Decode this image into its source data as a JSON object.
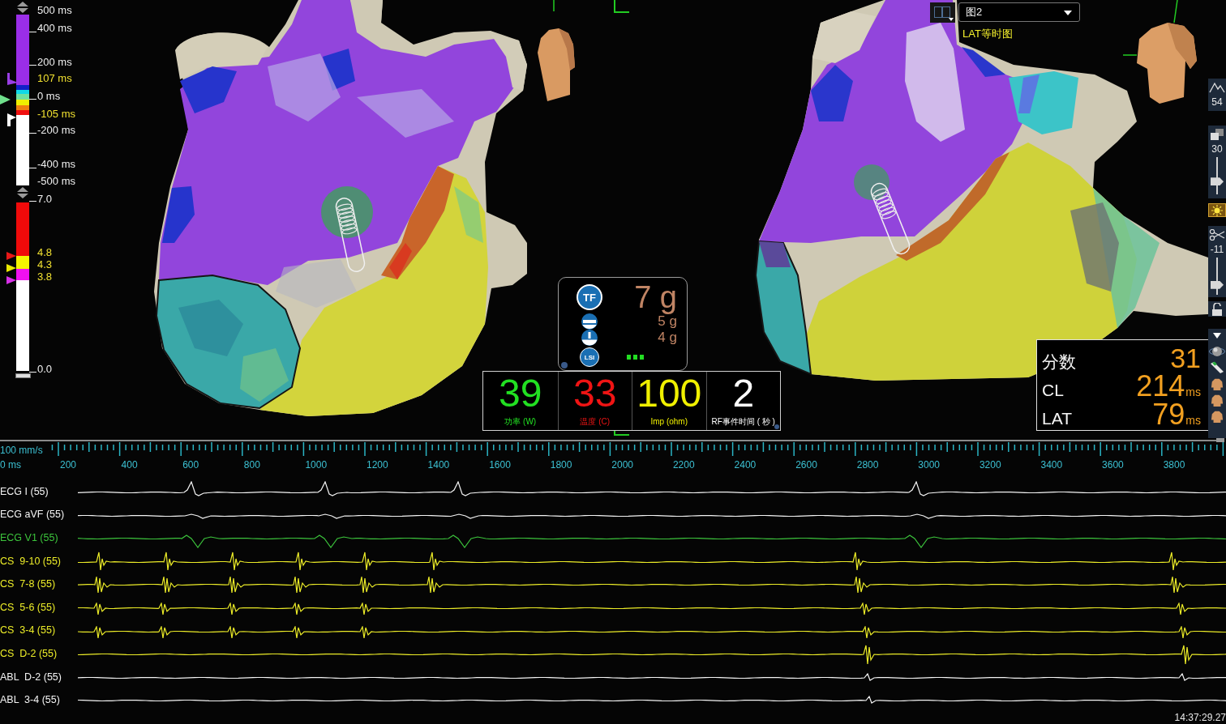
{
  "lat_scale": {
    "labels": [
      {
        "text": "500 ms",
        "kind": "tick"
      },
      {
        "text": "400 ms",
        "kind": "tick"
      },
      {
        "text": "200 ms",
        "kind": "tick"
      },
      {
        "text": "107 ms",
        "kind": "limit"
      },
      {
        "text": "0 ms",
        "kind": "tick"
      },
      {
        "text": "-105 ms",
        "kind": "limit"
      },
      {
        "text": "-200 ms",
        "kind": "tick"
      },
      {
        "text": "-400 ms",
        "kind": "tick"
      },
      {
        "text": "-500 ms",
        "kind": "tick"
      }
    ]
  },
  "voltage_scale": {
    "labels": [
      {
        "text": "7.0",
        "kind": "tick"
      },
      {
        "text": "4.8",
        "kind": "limit"
      },
      {
        "text": "4.3",
        "kind": "limit"
      },
      {
        "text": "3.8",
        "kind": "limit"
      },
      {
        "text": "0.0",
        "kind": "tick"
      }
    ]
  },
  "map_header": {
    "layout_value": "图2",
    "map_type": "LAT等时图"
  },
  "force_panel": {
    "tf_label": "TF",
    "total_force": "7 g",
    "components": [
      {
        "kind": "axial",
        "value": "5 g"
      },
      {
        "kind": "lateral",
        "value": "4 g"
      }
    ],
    "lsi_label": "LSI"
  },
  "rf_stats": [
    {
      "value": "39",
      "label": "功率 (W)",
      "color": "#22e022"
    },
    {
      "value": "33",
      "label": "温度 (C)",
      "color": "#f01414"
    },
    {
      "value": "100",
      "label": "Imp (ohm)",
      "color": "#f0f000"
    },
    {
      "value": "2",
      "label": "RF事件时间 ( 秒 )",
      "color": "#ffffff"
    }
  ],
  "score_panel": [
    {
      "label": "分数",
      "value": "31"
    },
    {
      "label": "CL",
      "value": "214",
      "unit": "ms"
    },
    {
      "label": "LAT",
      "value": "79",
      "unit": "ms"
    }
  ],
  "toolbar": [
    {
      "kind": "peak",
      "value": "54"
    },
    {
      "kind": "opacity",
      "value": "30",
      "level": 0.3
    },
    {
      "kind": "light",
      "on": true
    },
    {
      "kind": "clip",
      "value": "-11",
      "level": 0.2
    },
    {
      "kind": "lock"
    },
    {
      "kind": "views"
    }
  ],
  "ruler": {
    "speed": "100 mm/s",
    "origin": "0 ms",
    "labels": [
      "200",
      "400",
      "600",
      "800",
      "1000",
      "1200",
      "1400",
      "1600",
      "1800",
      "2000",
      "2200",
      "2400",
      "2600",
      "2800",
      "3000",
      "3200",
      "3400",
      "3600",
      "3800"
    ]
  },
  "channels": [
    {
      "name": "ECG I (55)",
      "color": "#f4f4f4"
    },
    {
      "name": "ECG aVF (55)",
      "color": "#f4f4f4"
    },
    {
      "name": "ECG V1 (55)",
      "color": "#3cc43c"
    },
    {
      "name": "CS  9-10 (55)",
      "color": "#ecec28"
    },
    {
      "name": "CS  7-8 (55)",
      "color": "#ecec28"
    },
    {
      "name": "CS  5-6 (55)",
      "color": "#ecec28"
    },
    {
      "name": "CS  3-4 (55)",
      "color": "#ecec28"
    },
    {
      "name": "CS  D-2 (55)",
      "color": "#ecec28"
    },
    {
      "name": "ABL  D-2 (55)",
      "color": "#f4f4f4"
    },
    {
      "name": "ABL  3-4 (55)",
      "color": "#f4f4f4"
    }
  ],
  "timestamp": "14:37:29.27"
}
